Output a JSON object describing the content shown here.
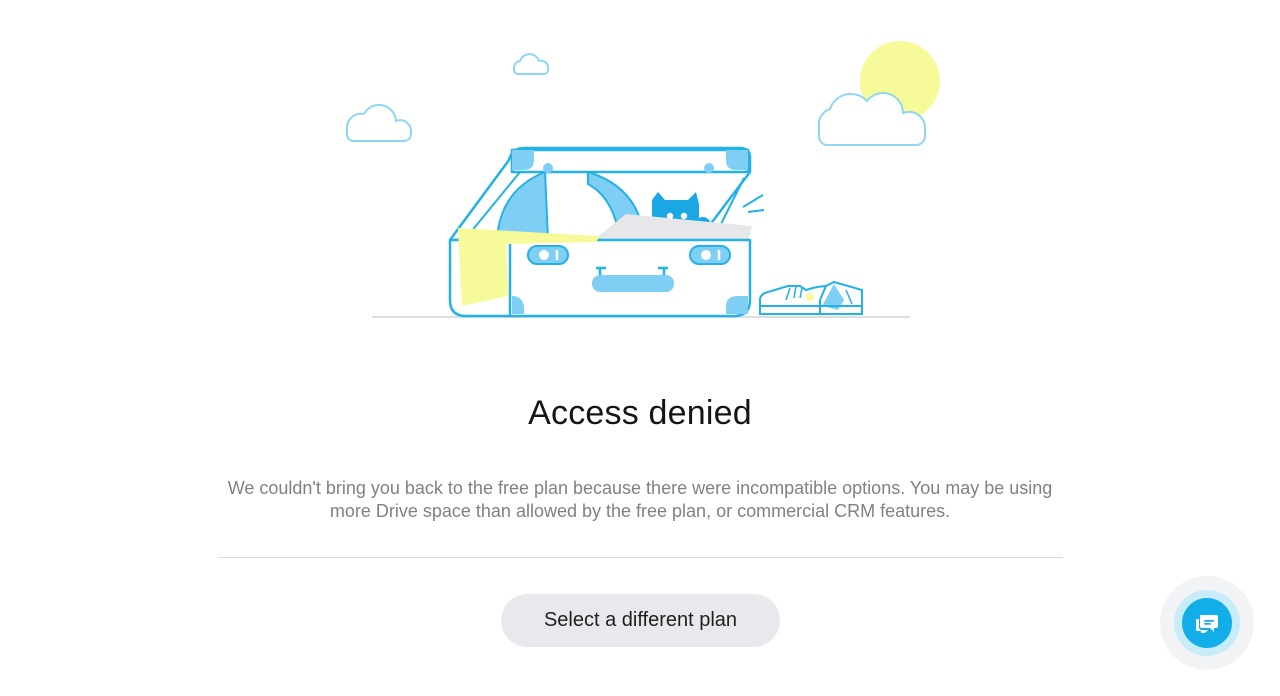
{
  "title": "Access denied",
  "description": "We couldn't bring you back to the free plan because there were incompatible options. You may be using more Drive space than allowed by the free plan, or commercial CRM features.",
  "button": {
    "label": "Select a different plan"
  },
  "chat_widget": {
    "icon": "chat-bubbles-icon"
  },
  "illustration": {
    "subject": "suitcase-with-cat-icon"
  },
  "colors": {
    "accent": "#12aeea",
    "illustration_blue": "#7fcff5",
    "illustration_yellow": "#f7fa98",
    "button_bg": "#e8e9ec",
    "text_muted": "#7f8185"
  }
}
